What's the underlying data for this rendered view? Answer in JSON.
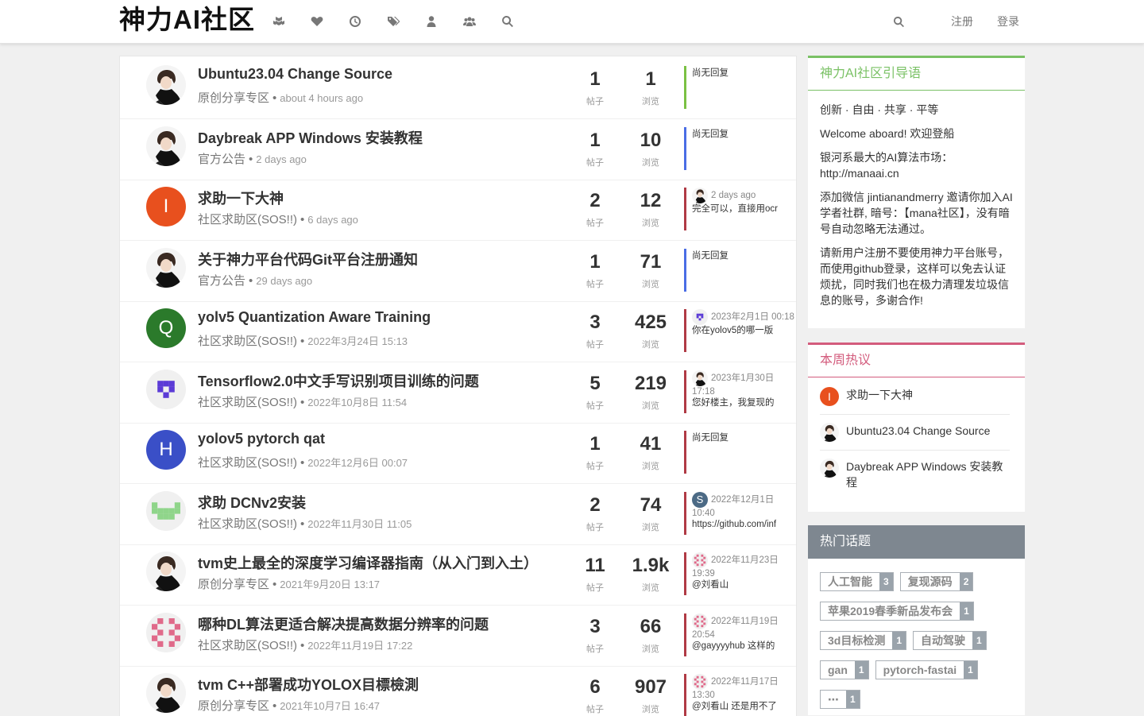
{
  "header": {
    "brand": "神力AI社区",
    "nav_icons": [
      "categories-icon",
      "popular-icon",
      "recent-icon",
      "tags-icon",
      "user-icon",
      "groups-icon",
      "search-icon"
    ],
    "register": "注册",
    "login": "登录"
  },
  "topics": [
    {
      "title": "Ubuntu23.04 Change Source",
      "category": "原创分享专区",
      "time": "about 4 hours ago",
      "posts": "1",
      "views": "1",
      "posts_label": "帖子",
      "views_label": "浏览",
      "teaser_time": "",
      "teaser": "尚无回复",
      "accent": "#7ac143",
      "avatar": "user",
      "avatar_letter": "",
      "avatar_color": ""
    },
    {
      "title": "Daybreak APP Windows 安装教程",
      "category": "官方公告",
      "time": "2 days ago",
      "posts": "1",
      "views": "10",
      "posts_label": "帖子",
      "views_label": "浏览",
      "teaser_time": "",
      "teaser": "尚无回复",
      "accent": "#4a6de5",
      "avatar": "user",
      "avatar_letter": "",
      "avatar_color": ""
    },
    {
      "title": "求助一下大神",
      "category": "社区求助区(SOS!!)",
      "time": "6 days ago",
      "posts": "2",
      "views": "12",
      "posts_label": "帖子",
      "views_label": "浏览",
      "teaser_time": "2 days ago",
      "teaser": "完全可以，直接用ocr",
      "accent": "#b03a45",
      "avatar": "letter",
      "avatar_letter": "I",
      "avatar_color": "#e8501e"
    },
    {
      "title": "关于神力平台代码Git平台注册通知",
      "category": "官方公告",
      "time": "29 days ago",
      "posts": "1",
      "views": "71",
      "posts_label": "帖子",
      "views_label": "浏览",
      "teaser_time": "",
      "teaser": "尚无回复",
      "accent": "#4a6de5",
      "avatar": "user",
      "avatar_letter": "",
      "avatar_color": ""
    },
    {
      "title": "yolv5 Quantization Aware Training",
      "category": "社区求助区(SOS!!)",
      "time": "2022年3月24日 15:13",
      "posts": "3",
      "views": "425",
      "posts_label": "帖子",
      "views_label": "浏览",
      "teaser_time": "2023年2月1日 00:18",
      "teaser": "你在yolov5的哪一版",
      "accent": "#b03a45",
      "avatar": "letter",
      "avatar_letter": "Q",
      "avatar_color": "#2b7a2b"
    },
    {
      "title": "Tensorflow2.0中文手写识别项目训练的问题",
      "category": "社区求助区(SOS!!)",
      "time": "2022年10月8日 11:54",
      "posts": "5",
      "views": "219",
      "posts_label": "帖子",
      "views_label": "浏览",
      "teaser_time": "2023年1月30日 17:18",
      "teaser": "您好楼主，我复现的",
      "accent": "#b03a45",
      "avatar": "identicon-purple",
      "avatar_letter": "",
      "avatar_color": ""
    },
    {
      "title": "yolov5 pytorch qat",
      "category": "社区求助区(SOS!!)",
      "time": "2022年12月6日 00:07",
      "posts": "1",
      "views": "41",
      "posts_label": "帖子",
      "views_label": "浏览",
      "teaser_time": "",
      "teaser": "尚无回复",
      "accent": "#b03a45",
      "avatar": "letter",
      "avatar_letter": "H",
      "avatar_color": "#3a4fc7"
    },
    {
      "title": "求助 DCNv2安装",
      "category": "社区求助区(SOS!!)",
      "time": "2022年11月30日 11:05",
      "posts": "2",
      "views": "74",
      "posts_label": "帖子",
      "views_label": "浏览",
      "teaser_time": "2022年12月1日 10:40",
      "teaser": "https://github.com/inf",
      "accent": "#b03a45",
      "avatar": "identicon-green",
      "avatar_letter": "",
      "avatar_color": ""
    },
    {
      "title": "tvm史上最全的深度学习编译器指南（从入门到入土）",
      "category": "原创分享专区",
      "time": "2021年9月20日 13:17",
      "posts": "11",
      "views": "1.9k",
      "posts_label": "帖子",
      "views_label": "浏览",
      "teaser_time": "2022年11月23日 19:39",
      "teaser": "@刘看山",
      "accent": "#b03a45",
      "avatar": "user",
      "avatar_letter": "",
      "avatar_color": ""
    },
    {
      "title": "哪种DL算法更适合解决提高数据分辨率的问题",
      "category": "社区求助区(SOS!!)",
      "time": "2022年11月19日 17:22",
      "posts": "3",
      "views": "66",
      "posts_label": "帖子",
      "views_label": "浏览",
      "teaser_time": "2022年11月19日 20:54",
      "teaser": "@gayyyyhub 这样的",
      "accent": "#b03a45",
      "avatar": "identicon-pink",
      "avatar_letter": "",
      "avatar_color": ""
    },
    {
      "title": "tvm C++部署成功YOLOX目標檢測",
      "category": "原创分享专区",
      "time": "2021年10月7日 16:47",
      "posts": "6",
      "views": "907",
      "posts_label": "帖子",
      "views_label": "浏览",
      "teaser_time": "2022年11月17日 13:30",
      "teaser": "@刘看山 还是用不了",
      "accent": "#b03a45",
      "avatar": "user",
      "avatar_letter": "",
      "avatar_color": ""
    }
  ],
  "guide": {
    "title": "神力AI社区引导语",
    "lines": [
      "创新 · 自由 · 共享 · 平等",
      "Welcome aboard! 欢迎登船",
      "银河系最大的AI算法市场：http://manaai.cn",
      "添加微信 jintianandmerry 邀请你加入AI学者社群, 暗号：【mana社区】，没有暗号自动忽略无法通过。",
      "请新用户注册不要使用神力平台账号，而使用github登录，这样可以免去认证烦扰，同时我们也在极力清理发垃圾信息的账号，多谢合作!"
    ]
  },
  "hot": {
    "title": "本周热议",
    "items": [
      {
        "label": "求助一下大神",
        "avatar": "letter",
        "letter": "I",
        "color": "#e8501e"
      },
      {
        "label": "Ubuntu23.04 Change Source",
        "avatar": "user",
        "letter": "",
        "color": ""
      },
      {
        "label": "Daybreak APP Windows 安装教程",
        "avatar": "user",
        "letter": "",
        "color": ""
      }
    ]
  },
  "tags": {
    "title": "热门话题",
    "rows": [
      [
        {
          "name": "人工智能",
          "count": "3"
        },
        {
          "name": "复现源码",
          "count": "2"
        }
      ],
      [
        {
          "name": "苹果2019春季新品发布会",
          "count": "1"
        }
      ],
      [
        {
          "name": "3d目标检测",
          "count": "1"
        },
        {
          "name": "自动驾驶",
          "count": "1"
        }
      ],
      [
        {
          "name": "gan",
          "count": "1"
        },
        {
          "name": "pytorch-fastai",
          "count": "1"
        }
      ],
      [
        {
          "name": "⋯",
          "count": "1"
        }
      ]
    ]
  }
}
